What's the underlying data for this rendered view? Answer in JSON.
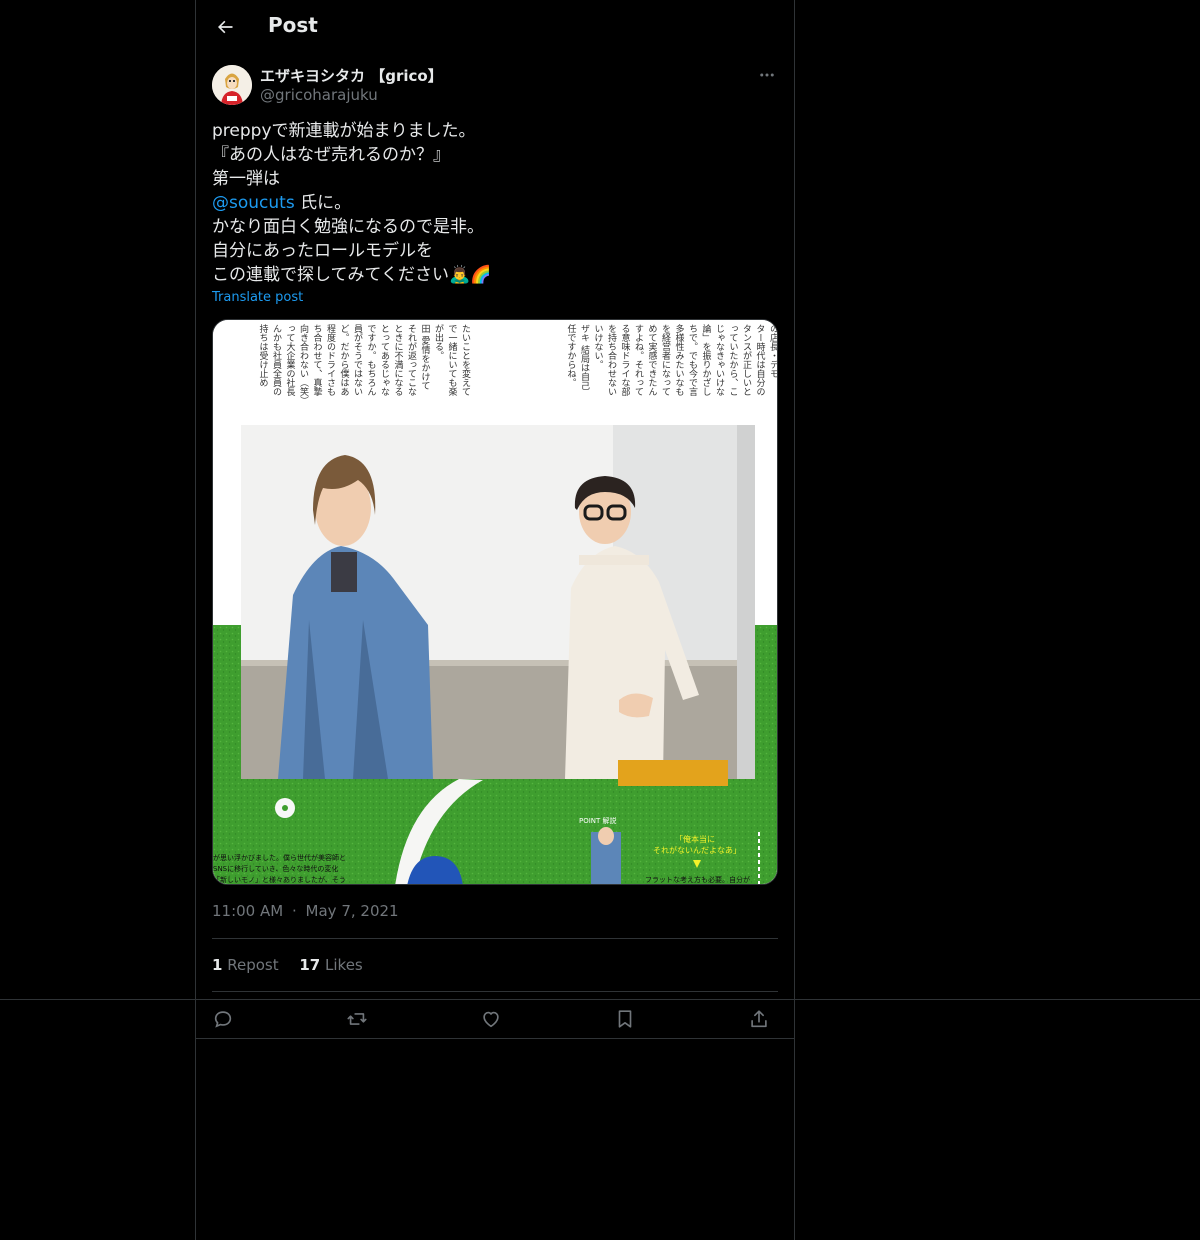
{
  "header": {
    "title": "Post"
  },
  "author": {
    "display_name": "エザキヨシタカ 【grico】",
    "handle": "@gricoharajuku"
  },
  "post": {
    "lines": [
      "preppyで新連載が始まりました。",
      "『あの人はなぜ売れるのか？』",
      "第一弾は"
    ],
    "mention": "@soucuts",
    "mention_suffix": " 氏に。",
    "lines_after": [
      "かなり面白く勉強になるので是非。",
      "自分にあったロールモデルを",
      "この連載で探してみてください🙇‍♂️🌈"
    ],
    "translate_label": "Translate post"
  },
  "media": {
    "column_texts": [
      "の店長・デモ",
      "ター時代は自分の",
      "タンスが正しいと",
      "っていたから、こ",
      "じゃなきゃいけな",
      "論」を振りかざし",
      "ちで。でも今で言",
      "多様性みたいなも",
      "を経営者になって",
      "めて実感できたん",
      "すよね。それって",
      "る意味ドライな部",
      "を持ち合わせない",
      "いけない。",
      "ザキ 結局は自己",
      "任ですからね。"
    ],
    "column_texts_2": [
      "たいことを変えて",
      "で一緒にいても楽",
      "が出る。",
      "田 愛情をかけて",
      "それが返ってこな",
      "ときに不満になる",
      "とってあるじゃな",
      "ですか。もちろん",
      "員がそうではない",
      "ど。だから僕はあ",
      "程度のドライさも",
      "ち合わせて、真摯",
      "向き合わない（笑）",
      "って大企業の社長",
      "んかも社員全員の",
      "持ちは受け止め"
    ],
    "point_label": "POINT 解説",
    "callout_line1": "「俺本当に",
    "callout_line2": "それがないんだよなあ」",
    "bottom_caption_1": "が思い浮かびました。僕ら世代が美容師と",
    "bottom_caption_2": "SNSに移行していき、色々な時代の変化",
    "bottom_caption_3": "「新しいモノ」と様々ありましたが、そう",
    "bottom_caption_right": "フラットな考え方も必要。自分が"
  },
  "meta": {
    "time": "11:00 AM",
    "dot": "·",
    "date": "May 7, 2021"
  },
  "stats": {
    "reposts": "1",
    "reposts_label": "Repost",
    "likes": "17",
    "likes_label": "Likes"
  },
  "icons": [
    "back-arrow-icon",
    "more-icon",
    "reply-icon",
    "repost-icon",
    "like-icon",
    "bookmark-icon",
    "share-icon"
  ]
}
